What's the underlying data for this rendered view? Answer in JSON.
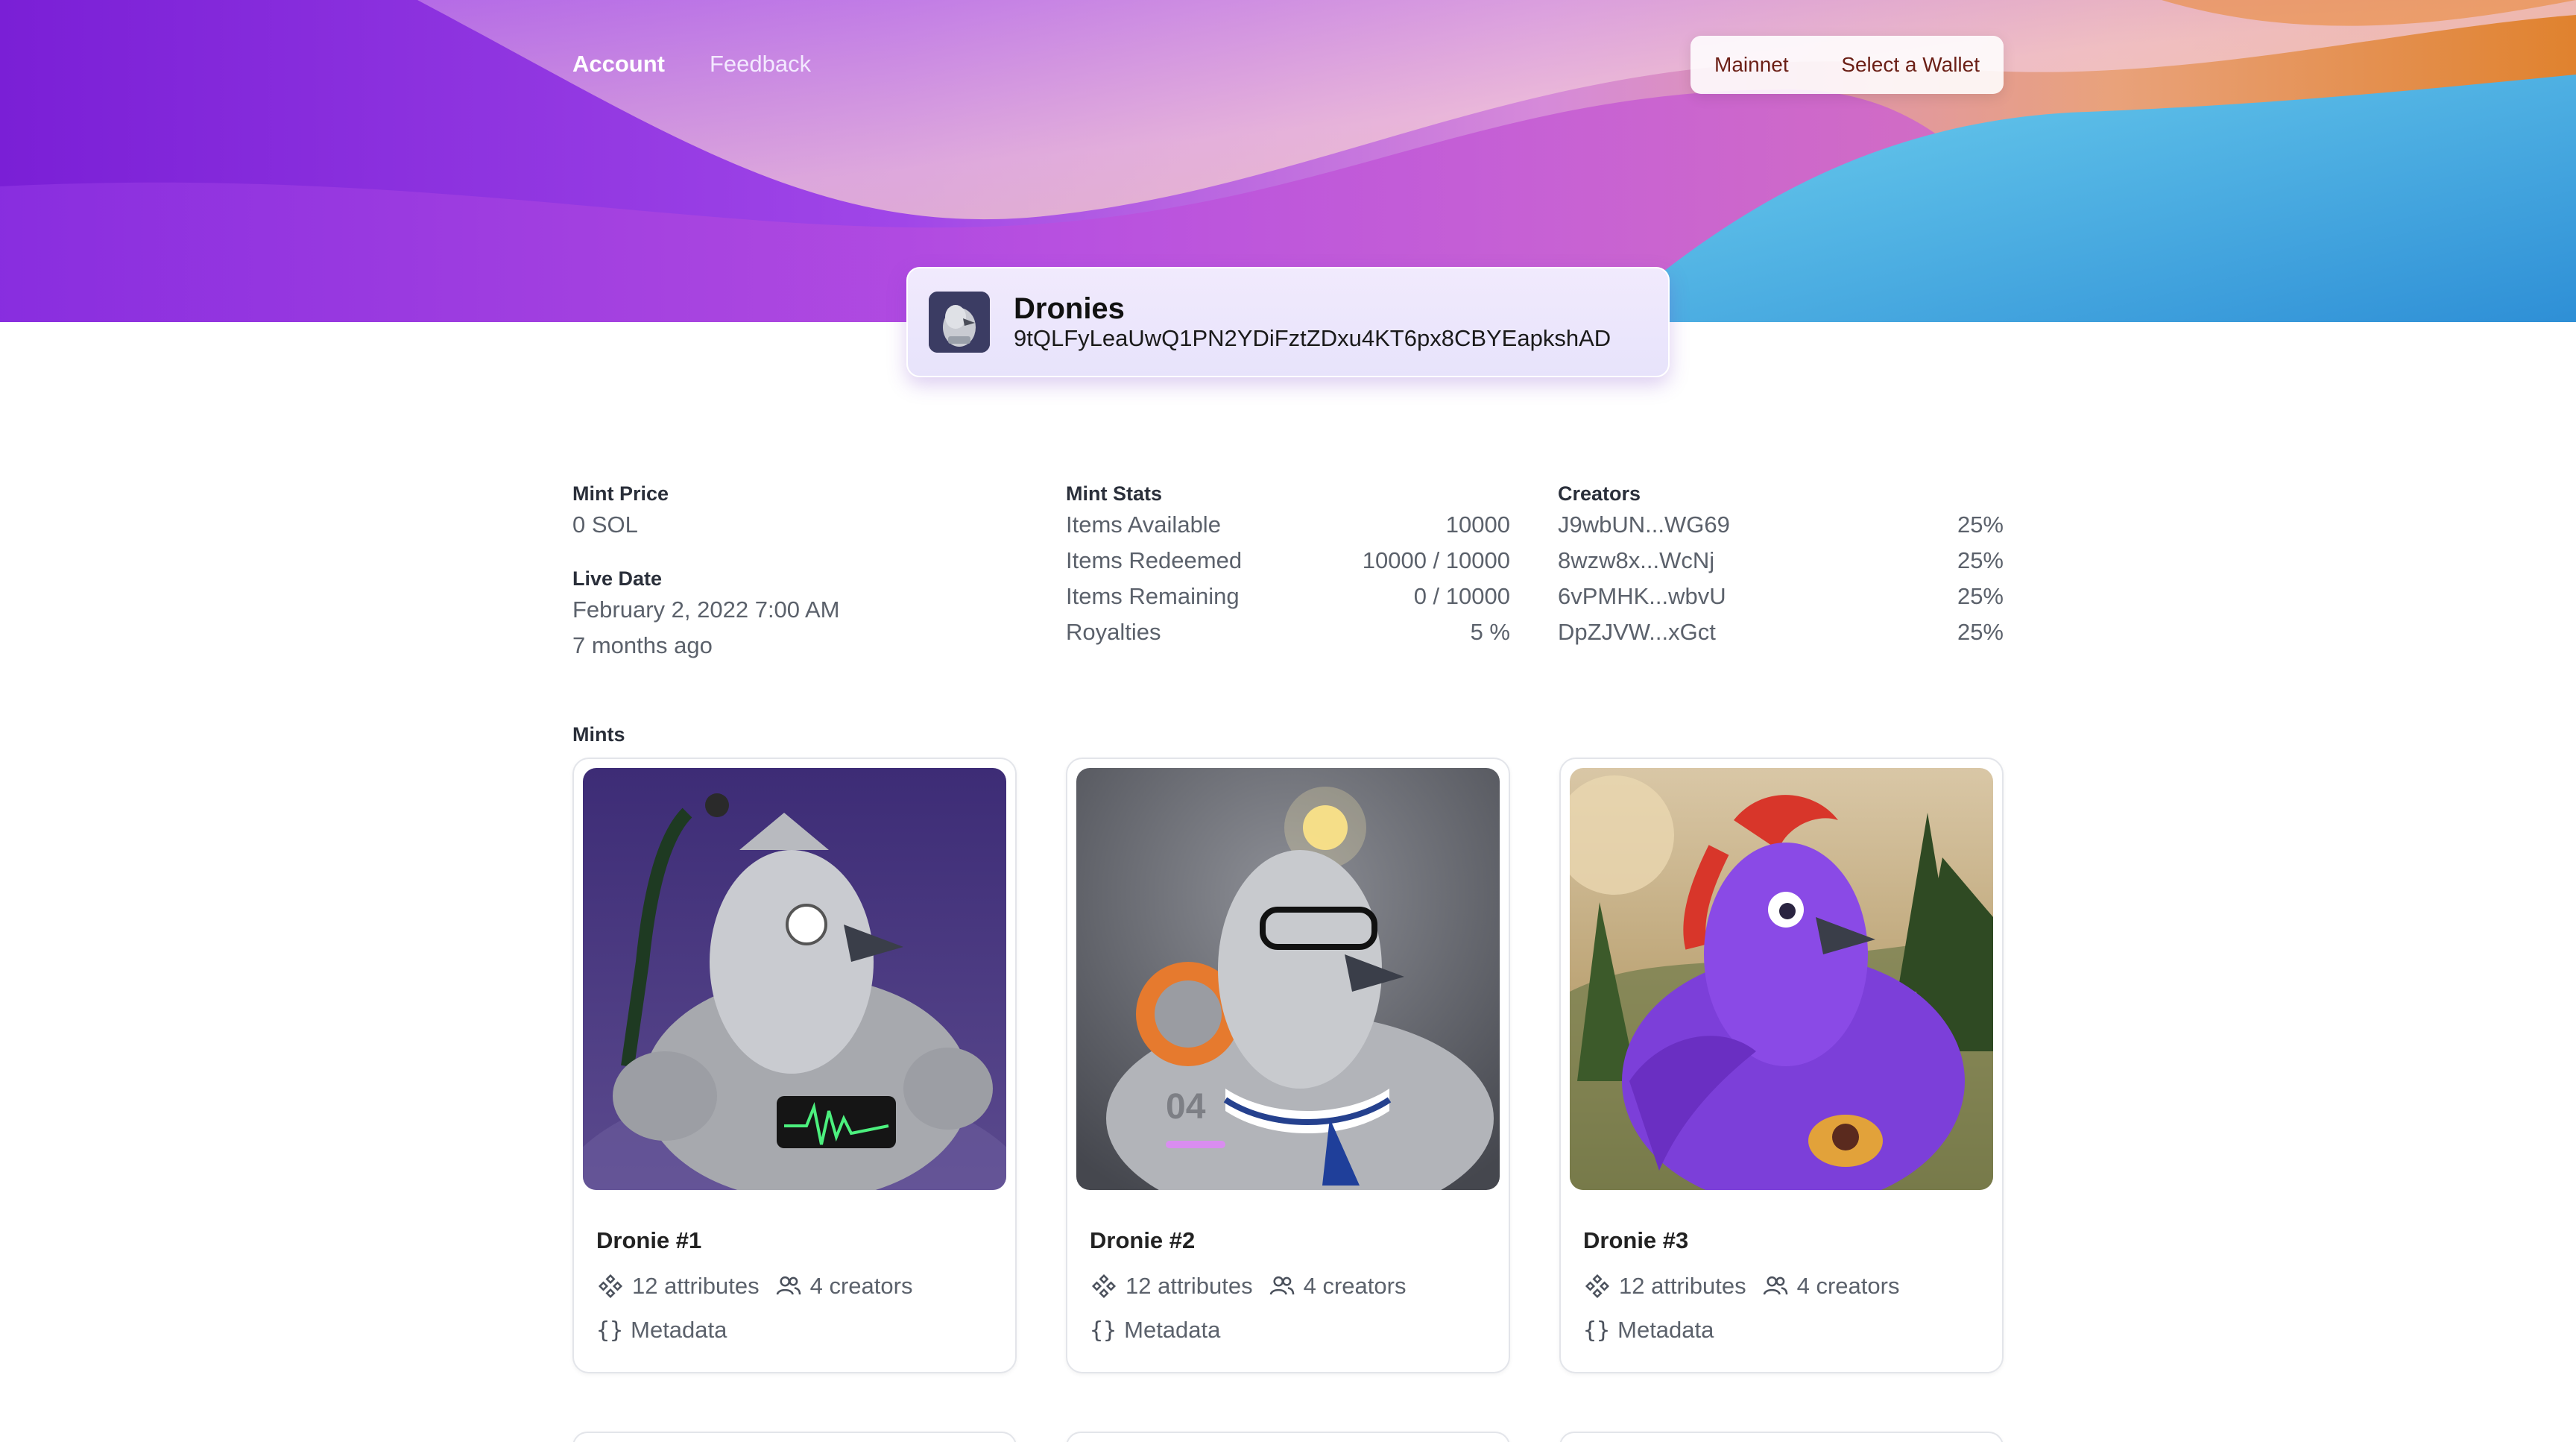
{
  "nav": {
    "items": [
      "Account",
      "Feedback"
    ],
    "active": "Account"
  },
  "wallet": {
    "network": "Mainnet",
    "select_label": "Select a Wallet"
  },
  "collection": {
    "name": "Dronies",
    "address": "9tQLFyLeaUwQ1PN2YDiFztZDxu4KT6px8CBYEapkshAD"
  },
  "mint_price": {
    "label": "Mint Price",
    "value": "0 SOL"
  },
  "live_date": {
    "label": "Live Date",
    "date": "February 2, 2022 7:00 AM",
    "relative": "7 months ago"
  },
  "mint_stats": {
    "label": "Mint Stats",
    "rows": [
      {
        "name": "Items Available",
        "value": "10000"
      },
      {
        "name": "Items Redeemed",
        "value": "10000 / 10000"
      },
      {
        "name": "Items Remaining",
        "value": "0 / 10000"
      },
      {
        "name": "Royalties",
        "value": "5 %"
      }
    ]
  },
  "creators": {
    "label": "Creators",
    "rows": [
      {
        "address": "J9wbUN...WG69",
        "share": "25%"
      },
      {
        "address": "8wzw8x...WcNj",
        "share": "25%"
      },
      {
        "address": "6vPMHK...wbvU",
        "share": "25%"
      },
      {
        "address": "DpZJVW...xGct",
        "share": "25%"
      }
    ]
  },
  "mints": {
    "label": "Mints",
    "items": [
      {
        "title": "Dronie #1",
        "attributes": "12 attributes",
        "creators": "4 creators",
        "metadata": "Metadata"
      },
      {
        "title": "Dronie #2",
        "attributes": "12 attributes",
        "creators": "4 creators",
        "metadata": "Metadata"
      },
      {
        "title": "Dronie #3",
        "attributes": "12 attributes",
        "creators": "4 creators",
        "metadata": "Metadata"
      }
    ]
  },
  "icons": {
    "attributes": "attributes-icon",
    "creators": "users-icon",
    "metadata": "braces-icon"
  },
  "colors": {
    "accent": "#8d2ee6",
    "wallet_text": "#6b1f16"
  }
}
